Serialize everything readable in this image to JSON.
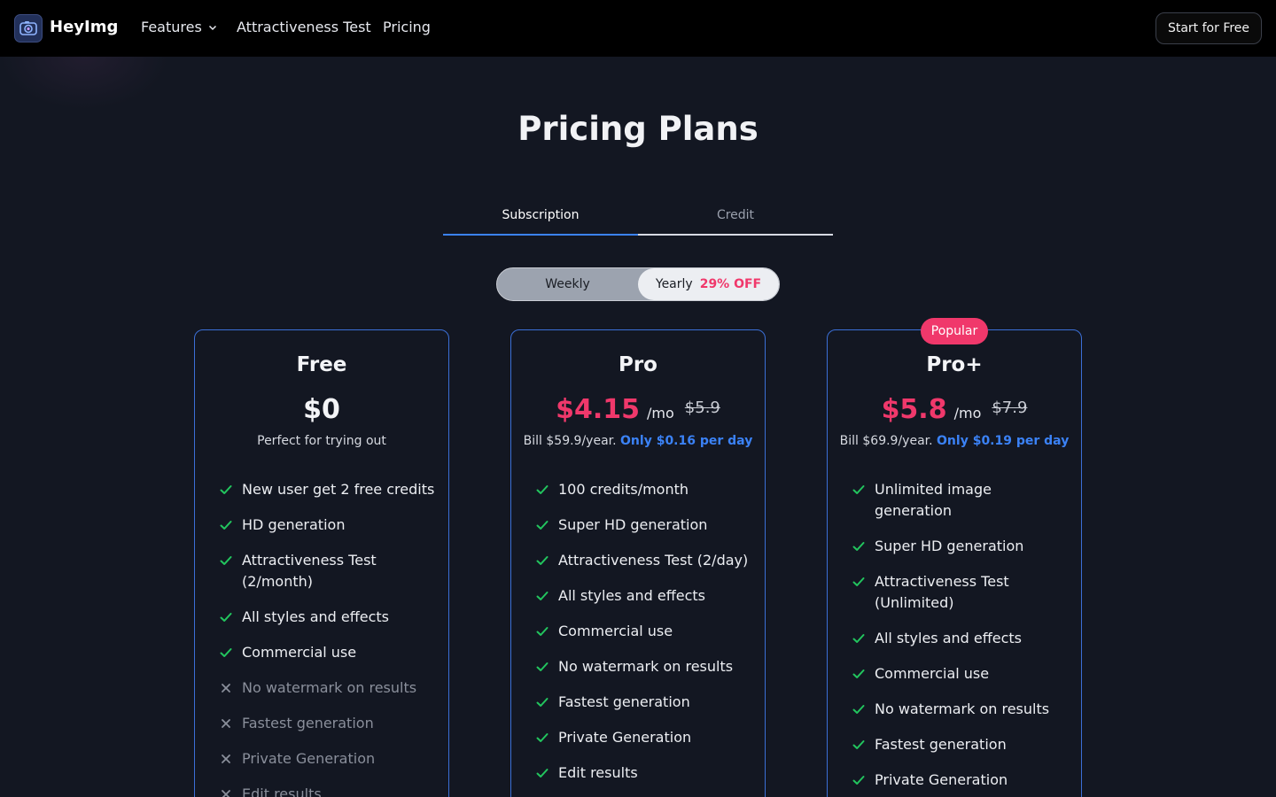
{
  "header": {
    "brand": "HeyImg",
    "nav": {
      "features": "Features",
      "attractiveness": "Attractiveness Test",
      "pricing": "Pricing"
    },
    "cta": "Start for Free"
  },
  "page": {
    "title": "Pricing Plans"
  },
  "tabs": {
    "subscription": "Subscription",
    "credit": "Credit",
    "active": "Subscription"
  },
  "billing": {
    "weekly": "Weekly",
    "yearly": "Yearly",
    "discount": "29% OFF",
    "selected": "Yearly"
  },
  "colors": {
    "accent_red": "#f0386b",
    "accent_blue": "#3b82f6",
    "check_green": "#22c55e"
  },
  "plans": {
    "free": {
      "name": "Free",
      "price": "$0",
      "subtitle": "Perfect for trying out",
      "features": [
        {
          "text": "New user get 2 free credits",
          "included": true
        },
        {
          "text": "HD generation",
          "included": true
        },
        {
          "text": "Attractiveness Test (2/month)",
          "included": true
        },
        {
          "text": "All styles and effects",
          "included": true
        },
        {
          "text": "Commercial use",
          "included": true
        },
        {
          "text": "No watermark on results",
          "included": false
        },
        {
          "text": "Fastest generation",
          "included": false
        },
        {
          "text": "Private Generation",
          "included": false
        },
        {
          "text": "Edit results",
          "included": false
        }
      ]
    },
    "pro": {
      "name": "Pro",
      "price": "$4.15",
      "per": "/mo",
      "old_price": "$5.9",
      "bill": "Bill $59.9/year.",
      "highlight": "Only $0.16 per day",
      "features": [
        {
          "text": "100 credits/month",
          "included": true
        },
        {
          "text": "Super HD generation",
          "included": true
        },
        {
          "text": "Attractiveness Test (2/day)",
          "included": true
        },
        {
          "text": "All styles and effects",
          "included": true
        },
        {
          "text": "Commercial use",
          "included": true
        },
        {
          "text": "No watermark on results",
          "included": true
        },
        {
          "text": "Fastest generation",
          "included": true
        },
        {
          "text": "Private Generation",
          "included": true
        },
        {
          "text": "Edit results",
          "included": true
        }
      ]
    },
    "proplus": {
      "badge": "Popular",
      "name": "Pro+",
      "price": "$5.8",
      "per": "/mo",
      "old_price": "$7.9",
      "bill": "Bill $69.9/year.",
      "highlight": "Only $0.19 per day",
      "features": [
        {
          "text": "Unlimited image generation",
          "included": true
        },
        {
          "text": "Super HD generation",
          "included": true
        },
        {
          "text": "Attractiveness Test (Unlimited)",
          "included": true
        },
        {
          "text": "All styles and effects",
          "included": true
        },
        {
          "text": "Commercial use",
          "included": true
        },
        {
          "text": "No watermark on results",
          "included": true
        },
        {
          "text": "Fastest generation",
          "included": true
        },
        {
          "text": "Private Generation",
          "included": true
        }
      ]
    }
  }
}
